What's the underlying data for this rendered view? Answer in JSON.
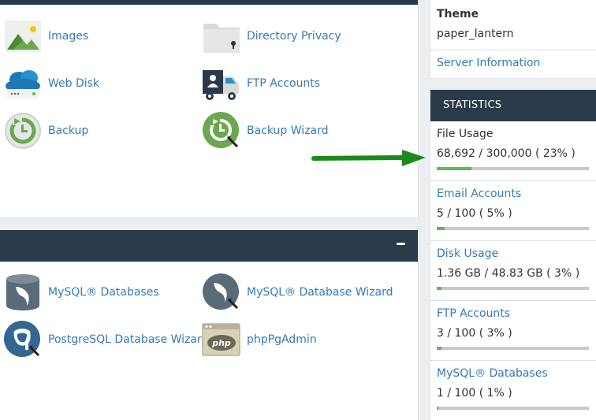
{
  "files_apps": [
    {
      "label": "Images",
      "icon": "images-icon"
    },
    {
      "label": "Directory Privacy",
      "icon": "directory-privacy-icon"
    },
    {
      "label": "Web Disk",
      "icon": "web-disk-icon"
    },
    {
      "label": "FTP Accounts",
      "icon": "ftp-accounts-icon"
    },
    {
      "label": "Backup",
      "icon": "backup-icon"
    },
    {
      "label": "Backup Wizard",
      "icon": "backup-wizard-icon"
    }
  ],
  "db_apps": [
    {
      "label": "MySQL® Databases",
      "icon": "mysql-database-icon"
    },
    {
      "label": "MySQL® Database Wizard",
      "icon": "mysql-wizard-icon"
    },
    {
      "label": "PostgreSQL Database Wizard",
      "icon": "postgresql-wizard-icon"
    },
    {
      "label": "phpPgAdmin",
      "icon": "phppgadmin-icon"
    }
  ],
  "sidebar": {
    "theme_label": "Theme",
    "theme_value": "paper_lantern",
    "server_info_link": "Server Information"
  },
  "statistics": {
    "title": "STATISTICS",
    "items": [
      {
        "name": "File Usage",
        "value": "68,692 / 300,000 ( 23% )",
        "percent": 23,
        "link": false
      },
      {
        "name": "Email Accounts",
        "value": "5 / 100 ( 5% )",
        "percent": 5,
        "link": true
      },
      {
        "name": "Disk Usage",
        "value": "1.36 GB / 48.83 GB ( 3% )",
        "percent": 3,
        "link": true
      },
      {
        "name": "FTP Accounts",
        "value": "3 / 100 ( 3% )",
        "percent": 3,
        "link": true
      },
      {
        "name": "MySQL® Databases",
        "value": "1 / 100 ( 1% )",
        "percent": 1,
        "link": true
      }
    ]
  },
  "colors": {
    "header": "#293a4a",
    "link": "#337ab7",
    "bar_fill": "#5cb85c",
    "arrow": "#1a8a1a"
  }
}
